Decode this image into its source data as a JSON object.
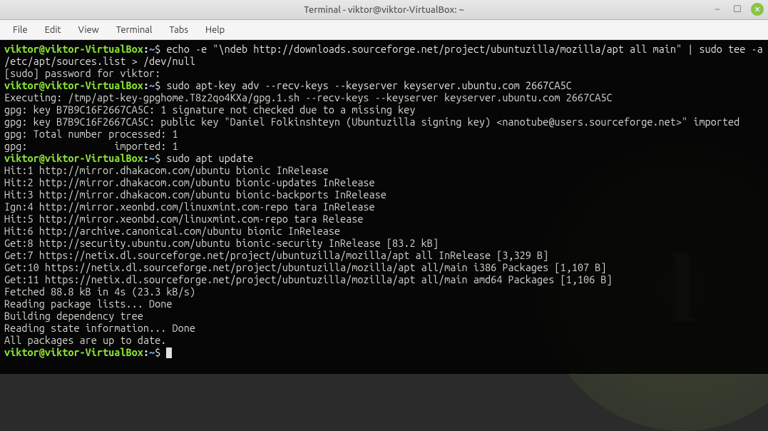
{
  "window": {
    "title": "Terminal - viktor@viktor-VirtualBox: ~"
  },
  "menu": {
    "file": "File",
    "edit": "Edit",
    "view": "View",
    "terminal": "Terminal",
    "tabs": "Tabs",
    "help": "Help"
  },
  "prompt": {
    "user_host": "viktor@viktor-VirtualBox",
    "path": "~",
    "symbol": "$"
  },
  "session": {
    "cmd1": "echo -e \"\\ndeb http://downloads.sourceforge.net/project/ubuntuzilla/mozilla/apt all main\" | sudo tee -a /etc/apt/sources.list > /dev/null",
    "out1": "[sudo] password for viktor:",
    "cmd2": "sudo apt-key adv --recv-keys --keyserver keyserver.ubuntu.com 2667CA5C",
    "out2a": "Executing: /tmp/apt-key-gpghome.T8z2qo4KXa/gpg.1.sh --recv-keys --keyserver keyserver.ubuntu.com 2667CA5C",
    "out2b": "gpg: key B7B9C16F2667CA5C: 1 signature not checked due to a missing key",
    "out2c": "gpg: key B7B9C16F2667CA5C: public key \"Daniel Folkinshteyn (Ubuntuzilla signing key) <nanotube@users.sourceforge.net>\" imported",
    "out2d": "gpg: Total number processed: 1",
    "out2e": "gpg:               imported: 1",
    "cmd3": "sudo apt update",
    "out3a": "Hit:1 http://mirror.dhakacom.com/ubuntu bionic InRelease",
    "out3b": "Hit:2 http://mirror.dhakacom.com/ubuntu bionic-updates InRelease",
    "out3c": "Hit:3 http://mirror.dhakacom.com/ubuntu bionic-backports InRelease",
    "out3d": "Ign:4 http://mirror.xeonbd.com/linuxmint.com-repo tara InRelease",
    "out3e": "Hit:5 http://mirror.xeonbd.com/linuxmint.com-repo tara Release",
    "out3f": "Hit:6 http://archive.canonical.com/ubuntu bionic InRelease",
    "out3g": "Get:8 http://security.ubuntu.com/ubuntu bionic-security InRelease [83.2 kB]",
    "out3h": "Get:7 https://netix.dl.sourceforge.net/project/ubuntuzilla/mozilla/apt all InRelease [3,329 B]",
    "out3i": "Get:10 https://netix.dl.sourceforge.net/project/ubuntuzilla/mozilla/apt all/main i386 Packages [1,107 B]",
    "out3j": "Get:11 https://netix.dl.sourceforge.net/project/ubuntuzilla/mozilla/apt all/main amd64 Packages [1,106 B]",
    "out3k": "Fetched 88.8 kB in 4s (23.3 kB/s)",
    "out3l": "Reading package lists... Done",
    "out3m": "Building dependency tree",
    "out3n": "Reading state information... Done",
    "out3o": "All packages are up to date."
  }
}
